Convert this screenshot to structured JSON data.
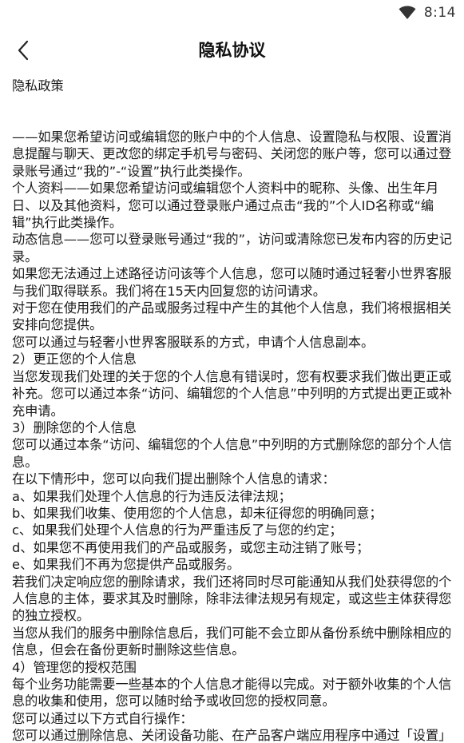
{
  "status_bar": {
    "time": "8:14",
    "icons": [
      "wifi-icon"
    ]
  },
  "header": {
    "title": "隐私协议",
    "back_icon": "chevron-left-icon"
  },
  "document": {
    "heading": "隐私政策",
    "paragraphs": [
      "——如果您希望访问或编辑您的账户中的个人信息、设置隐私与权限、设置消息提醒与聊天、更改您的绑定手机号与密码、关闭您的账户等，您可以通过登录账号通过“我的”-“设置”执行此类操作。",
      "个人资料——如果您希望访问或编辑您个人资料中的昵称、头像、出生年月日、以及其他资料，您可以通过登录账户通过点击“我的”个人ID名称或“编辑”执行此类操作。",
      "动态信息——您可以登录账号通过“我的”，访问或清除您已发布内容的历史记录。",
      "如果您无法通过上述路径访问该等个人信息，您可以随时通过轻奢小世界客服与我们取得联系。我们将在15天内回复您的访问请求。",
      "对于您在使用我们的产品或服务过程中产生的其他个人信息，我们将根据相关安排向您提供。",
      "您可以通过与轻奢小世界客服联系的方式，申请个人信息副本。",
      "2）更正您的个人信息",
      "当您发现我们处理的关于您的个人信息有错误时，您有权要求我们做出更正或补充。您可以通过本条“访问、编辑您的个人信息”中列明的方式提出更正或补充申请。",
      "3）删除您的个人信息",
      "您可以通过本条“访问、编辑您的个人信息”中列明的方式删除您的部分个人信息。",
      "在以下情形中，您可以向我们提出删除个人信息的请求：",
      "a、如果我们处理个人信息的行为违反法律法规；",
      "b、如果我们收集、使用您的个人信息，却未征得您的明确同意；",
      "c、如果我们处理个人信息的行为严重违反了与您的约定；",
      "d、如果您不再使用我们的产品或服务，或您主动注销了账号；",
      "e、如果我们不再为您提供产品或服务。",
      "若我们决定响应您的删除请求，我们还将同时尽可能通知从我们处获得您的个人信息的主体，要求其及时删除，除非法律法规另有规定，或这些主体获得您的独立授权。",
      "当您从我们的服务中删除信息后，我们可能不会立即从备份系统中删除相应的信息，但会在备份更新时删除这些信息。",
      "4）管理您的授权范围",
      "每个业务功能需要一些基本的个人信息才能得以完成。对于额外收集的个人信息的收集和使用，您可以随时给予或收回您的授权同意。",
      "您可以通过以下方式自行操作：",
      "您可以通过删除信息、关闭设备功能、在产品客户端应用程序中通过「设置」-「账号与安全」-推送设置、隐私设置」，改变您在功能和服"
    ]
  }
}
